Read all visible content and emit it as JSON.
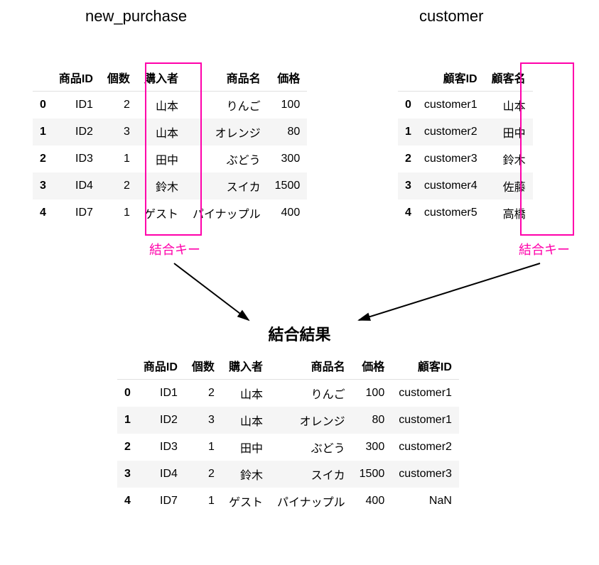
{
  "titles": {
    "left": "new_purchase",
    "right": "customer",
    "result": "結合結果"
  },
  "key_label": "結合キー",
  "colors": {
    "highlight": "#ff00aa"
  },
  "purchase": {
    "columns": [
      "商品ID",
      "個数",
      "購入者",
      "商品名",
      "価格"
    ],
    "rows": [
      {
        "idx": "0",
        "商品ID": "ID1",
        "個数": "2",
        "購入者": "山本",
        "商品名": "りんご",
        "価格": "100"
      },
      {
        "idx": "1",
        "商品ID": "ID2",
        "個数": "3",
        "購入者": "山本",
        "商品名": "オレンジ",
        "価格": "80"
      },
      {
        "idx": "2",
        "商品ID": "ID3",
        "個数": "1",
        "購入者": "田中",
        "商品名": "ぶどう",
        "価格": "300"
      },
      {
        "idx": "3",
        "商品ID": "ID4",
        "個数": "2",
        "購入者": "鈴木",
        "商品名": "スイカ",
        "価格": "1500"
      },
      {
        "idx": "4",
        "商品ID": "ID7",
        "個数": "1",
        "購入者": "ゲスト",
        "商品名": "パイナップル",
        "価格": "400"
      }
    ]
  },
  "customer": {
    "columns": [
      "顧客ID",
      "顧客名"
    ],
    "rows": [
      {
        "idx": "0",
        "顧客ID": "customer1",
        "顧客名": "山本"
      },
      {
        "idx": "1",
        "顧客ID": "customer2",
        "顧客名": "田中"
      },
      {
        "idx": "2",
        "顧客ID": "customer3",
        "顧客名": "鈴木"
      },
      {
        "idx": "3",
        "顧客ID": "customer4",
        "顧客名": "佐藤"
      },
      {
        "idx": "4",
        "顧客ID": "customer5",
        "顧客名": "高橋"
      }
    ]
  },
  "result": {
    "columns": [
      "商品ID",
      "個数",
      "購入者",
      "商品名",
      "価格",
      "顧客ID"
    ],
    "rows": [
      {
        "idx": "0",
        "商品ID": "ID1",
        "個数": "2",
        "購入者": "山本",
        "商品名": "りんご",
        "価格": "100",
        "顧客ID": "customer1"
      },
      {
        "idx": "1",
        "商品ID": "ID2",
        "個数": "3",
        "購入者": "山本",
        "商品名": "オレンジ",
        "価格": "80",
        "顧客ID": "customer1"
      },
      {
        "idx": "2",
        "商品ID": "ID3",
        "個数": "1",
        "購入者": "田中",
        "商品名": "ぶどう",
        "価格": "300",
        "顧客ID": "customer2"
      },
      {
        "idx": "3",
        "商品ID": "ID4",
        "個数": "2",
        "購入者": "鈴木",
        "商品名": "スイカ",
        "価格": "1500",
        "顧客ID": "customer3"
      },
      {
        "idx": "4",
        "商品ID": "ID7",
        "個数": "1",
        "購入者": "ゲスト",
        "商品名": "パイナップル",
        "価格": "400",
        "顧客ID": "NaN"
      }
    ]
  },
  "chart_data": {
    "type": "table",
    "join": {
      "left_table": "new_purchase",
      "right_table": "customer",
      "left_key": "購入者",
      "right_key": "顧客名",
      "how": "left"
    }
  }
}
